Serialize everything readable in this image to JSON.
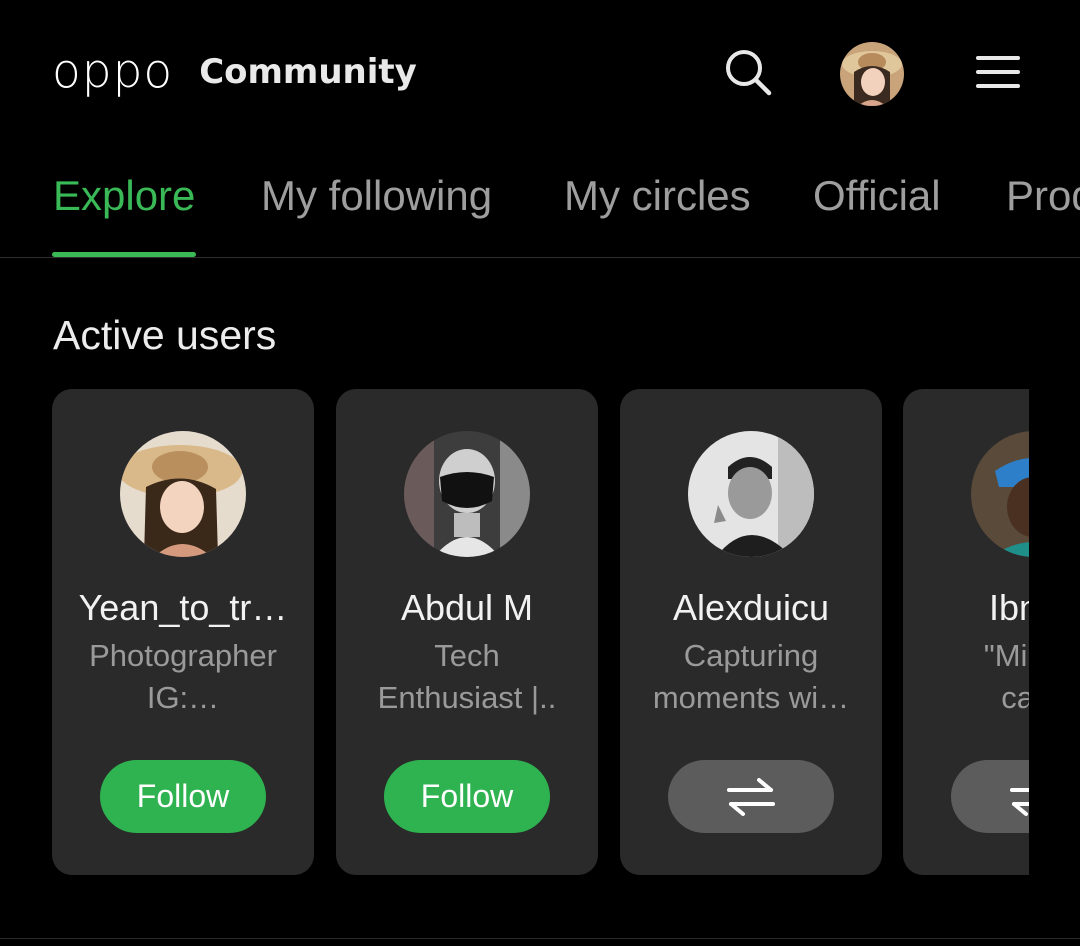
{
  "header": {
    "logo_text": "oppo",
    "subtitle": "Community",
    "icons": [
      "search-icon",
      "profile-avatar",
      "menu-icon"
    ]
  },
  "tabs": [
    {
      "label": "Explore",
      "active": true
    },
    {
      "label": "My following",
      "active": false
    },
    {
      "label": "My circles",
      "active": false
    },
    {
      "label": "Official",
      "active": false
    },
    {
      "label": "Products",
      "active": false
    }
  ],
  "section": {
    "title": "Active users"
  },
  "users": [
    {
      "name": "Yean_to_tr…",
      "bio_line1": "Photographer",
      "bio_line2": "IG:…",
      "action": "Follow",
      "state": "follow"
    },
    {
      "name": "Abdul M",
      "bio_line1": "Tech",
      "bio_line2": "Enthusiast |..",
      "action": "Follow",
      "state": "follow"
    },
    {
      "name": "Alexduicu",
      "bio_line1": "Capturing",
      "bio_line2": "moments wi…",
      "action": "",
      "state": "mutual"
    },
    {
      "name": "Ibn M",
      "bio_line1": "\"Mi cas",
      "bio_line2": "casa",
      "action": "",
      "state": "mutual"
    }
  ],
  "colors": {
    "accent": "#3ab957",
    "follow_button": "#2fb350",
    "card_bg": "#2a2a2a",
    "background": "#000000"
  }
}
